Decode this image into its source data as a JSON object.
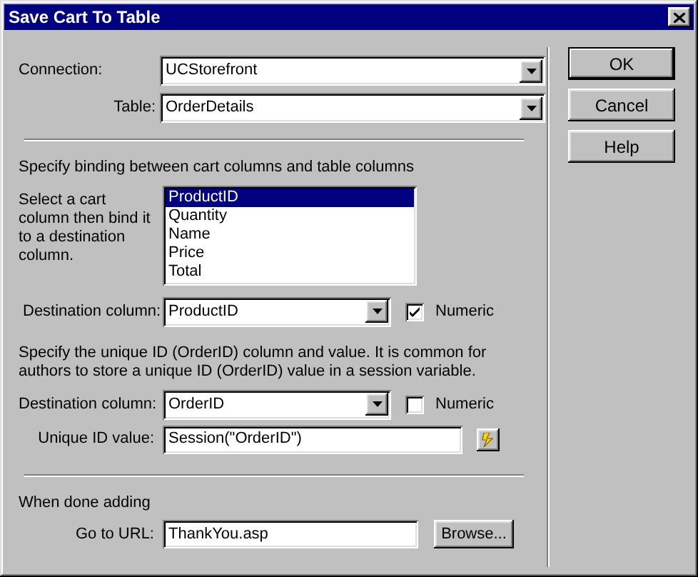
{
  "window": {
    "title": "Save Cart To Table"
  },
  "connection": {
    "label": "Connection:",
    "value": "UCStorefront"
  },
  "table": {
    "label": "Table:",
    "value": "OrderDetails"
  },
  "binding": {
    "heading": "Specify binding between cart columns and table columns",
    "instructions": "Select a cart column then bind it to a destination column.",
    "columns": [
      {
        "label": "ProductID",
        "selected": true
      },
      {
        "label": "Quantity",
        "selected": false
      },
      {
        "label": "Name",
        "selected": false
      },
      {
        "label": "Price",
        "selected": false
      },
      {
        "label": "Total",
        "selected": false
      }
    ],
    "destination": {
      "label": "Destination column:",
      "value": "ProductID"
    },
    "numeric": {
      "label": "Numeric",
      "checked": true
    }
  },
  "unique_id": {
    "description": "Specify the unique ID (OrderID) column and value. It is common for authors to store a unique ID (OrderID) value in a session variable.",
    "destination": {
      "label": "Destination column:",
      "value": "OrderID"
    },
    "numeric": {
      "label": "Numeric",
      "checked": false
    },
    "value": {
      "label": "Unique ID value:",
      "value": "Session(\"OrderID\")"
    }
  },
  "done": {
    "heading": "When done adding",
    "url": {
      "label": "Go to URL:",
      "value": "ThankYou.asp"
    },
    "browse": "Browse..."
  },
  "buttons": [
    {
      "label": "OK",
      "default": true
    },
    {
      "label": "Cancel",
      "default": false
    },
    {
      "label": "Help",
      "default": false
    }
  ]
}
